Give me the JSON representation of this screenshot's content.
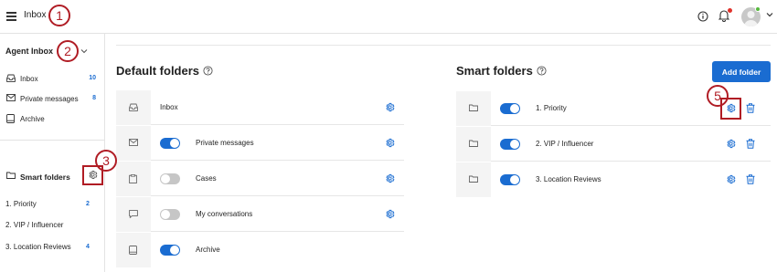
{
  "header": {
    "title": "Inbox",
    "icons": [
      "menu-icon",
      "info-icon",
      "bell-icon",
      "avatar",
      "chevron-down-icon"
    ],
    "colors": {
      "accent": "#1a6cd1",
      "notification": "#e0322b",
      "presence": "#55b83c"
    }
  },
  "callouts": [
    "1",
    "2",
    "3",
    "5"
  ],
  "sidebar": {
    "title": "Agent Inbox",
    "items": [
      {
        "label": "Inbox",
        "count": "10",
        "icon": "inbox-icon"
      },
      {
        "label": "Private messages",
        "count": "8",
        "icon": "envelope-icon"
      },
      {
        "label": "Archive",
        "count": "",
        "icon": "archive-icon"
      }
    ],
    "smart_title": "Smart folders",
    "smart_items": [
      {
        "label": "1. Priority",
        "count": "2"
      },
      {
        "label": "2. VIP / Influencer",
        "count": ""
      },
      {
        "label": "3. Location Reviews",
        "count": "4"
      }
    ]
  },
  "default_folders": {
    "title": "Default folders",
    "rows": [
      {
        "name": "Inbox",
        "icon": "inbox-icon",
        "toggle": null
      },
      {
        "name": "Private messages",
        "icon": "envelope-icon",
        "toggle": "on"
      },
      {
        "name": "Cases",
        "icon": "clipboard-icon",
        "toggle": "off"
      },
      {
        "name": "My conversations",
        "icon": "chat-icon",
        "toggle": "off"
      },
      {
        "name": "Archive",
        "icon": "archive-icon",
        "toggle": "on"
      }
    ]
  },
  "smart_folders": {
    "title": "Smart folders",
    "add_button": "Add folder",
    "rows": [
      {
        "name": "1. Priority",
        "toggle": "on"
      },
      {
        "name": "2. VIP / Influencer",
        "toggle": "on"
      },
      {
        "name": "3. Location Reviews",
        "toggle": "on"
      }
    ]
  }
}
